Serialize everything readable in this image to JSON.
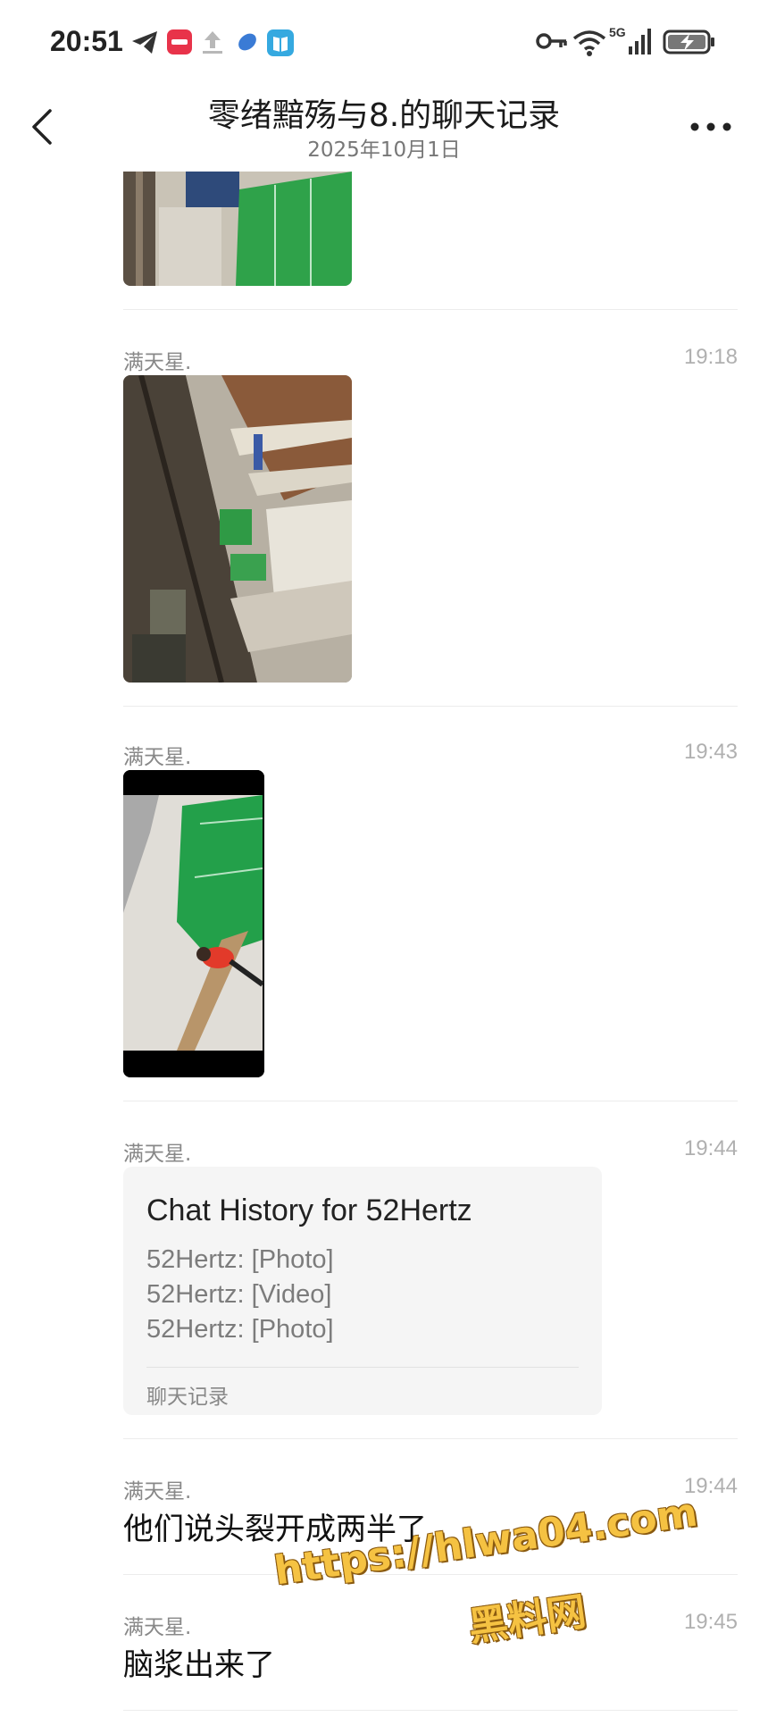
{
  "status_bar": {
    "time": "20:51",
    "icons": [
      "telegram-icon",
      "app-badge-icon",
      "upload-icon",
      "feather-app-icon",
      "reader-app-icon",
      "vpn-key-icon",
      "wifi-icon",
      "5g-signal-icon",
      "battery-charging-icon"
    ]
  },
  "header": {
    "title": "零绪黯殇与8.的聊天记录",
    "subtitle": "2025年10月1日",
    "back_icon": "chevron-left-icon",
    "more_icon": "more-dots-icon"
  },
  "messages": [
    {
      "type": "image",
      "sender": "",
      "time": ""
    },
    {
      "type": "image",
      "sender": "满天星.",
      "time": "19:18"
    },
    {
      "type": "video",
      "sender": "满天星.",
      "time": "19:43"
    },
    {
      "type": "chat_history",
      "sender": "满天星.",
      "time": "19:44",
      "card": {
        "title": "Chat History for 52Hertz",
        "lines": [
          "52Hertz: [Photo]",
          "52Hertz: [Video]",
          "52Hertz: [Photo]"
        ],
        "footer": "聊天记录"
      }
    },
    {
      "type": "text",
      "sender": "满天星.",
      "time": "19:44",
      "text": "他们说头裂开成两半了"
    },
    {
      "type": "text",
      "sender": "满天星.",
      "time": "19:45",
      "text": "脑浆出来了"
    }
  ],
  "watermark": {
    "url": "https://hlwa04.com",
    "name": "黑料网"
  },
  "colors": {
    "background": "#ffffff",
    "card_background": "#f5f5f5",
    "watermark": "#f5c242",
    "secondary_text": "#888888"
  }
}
